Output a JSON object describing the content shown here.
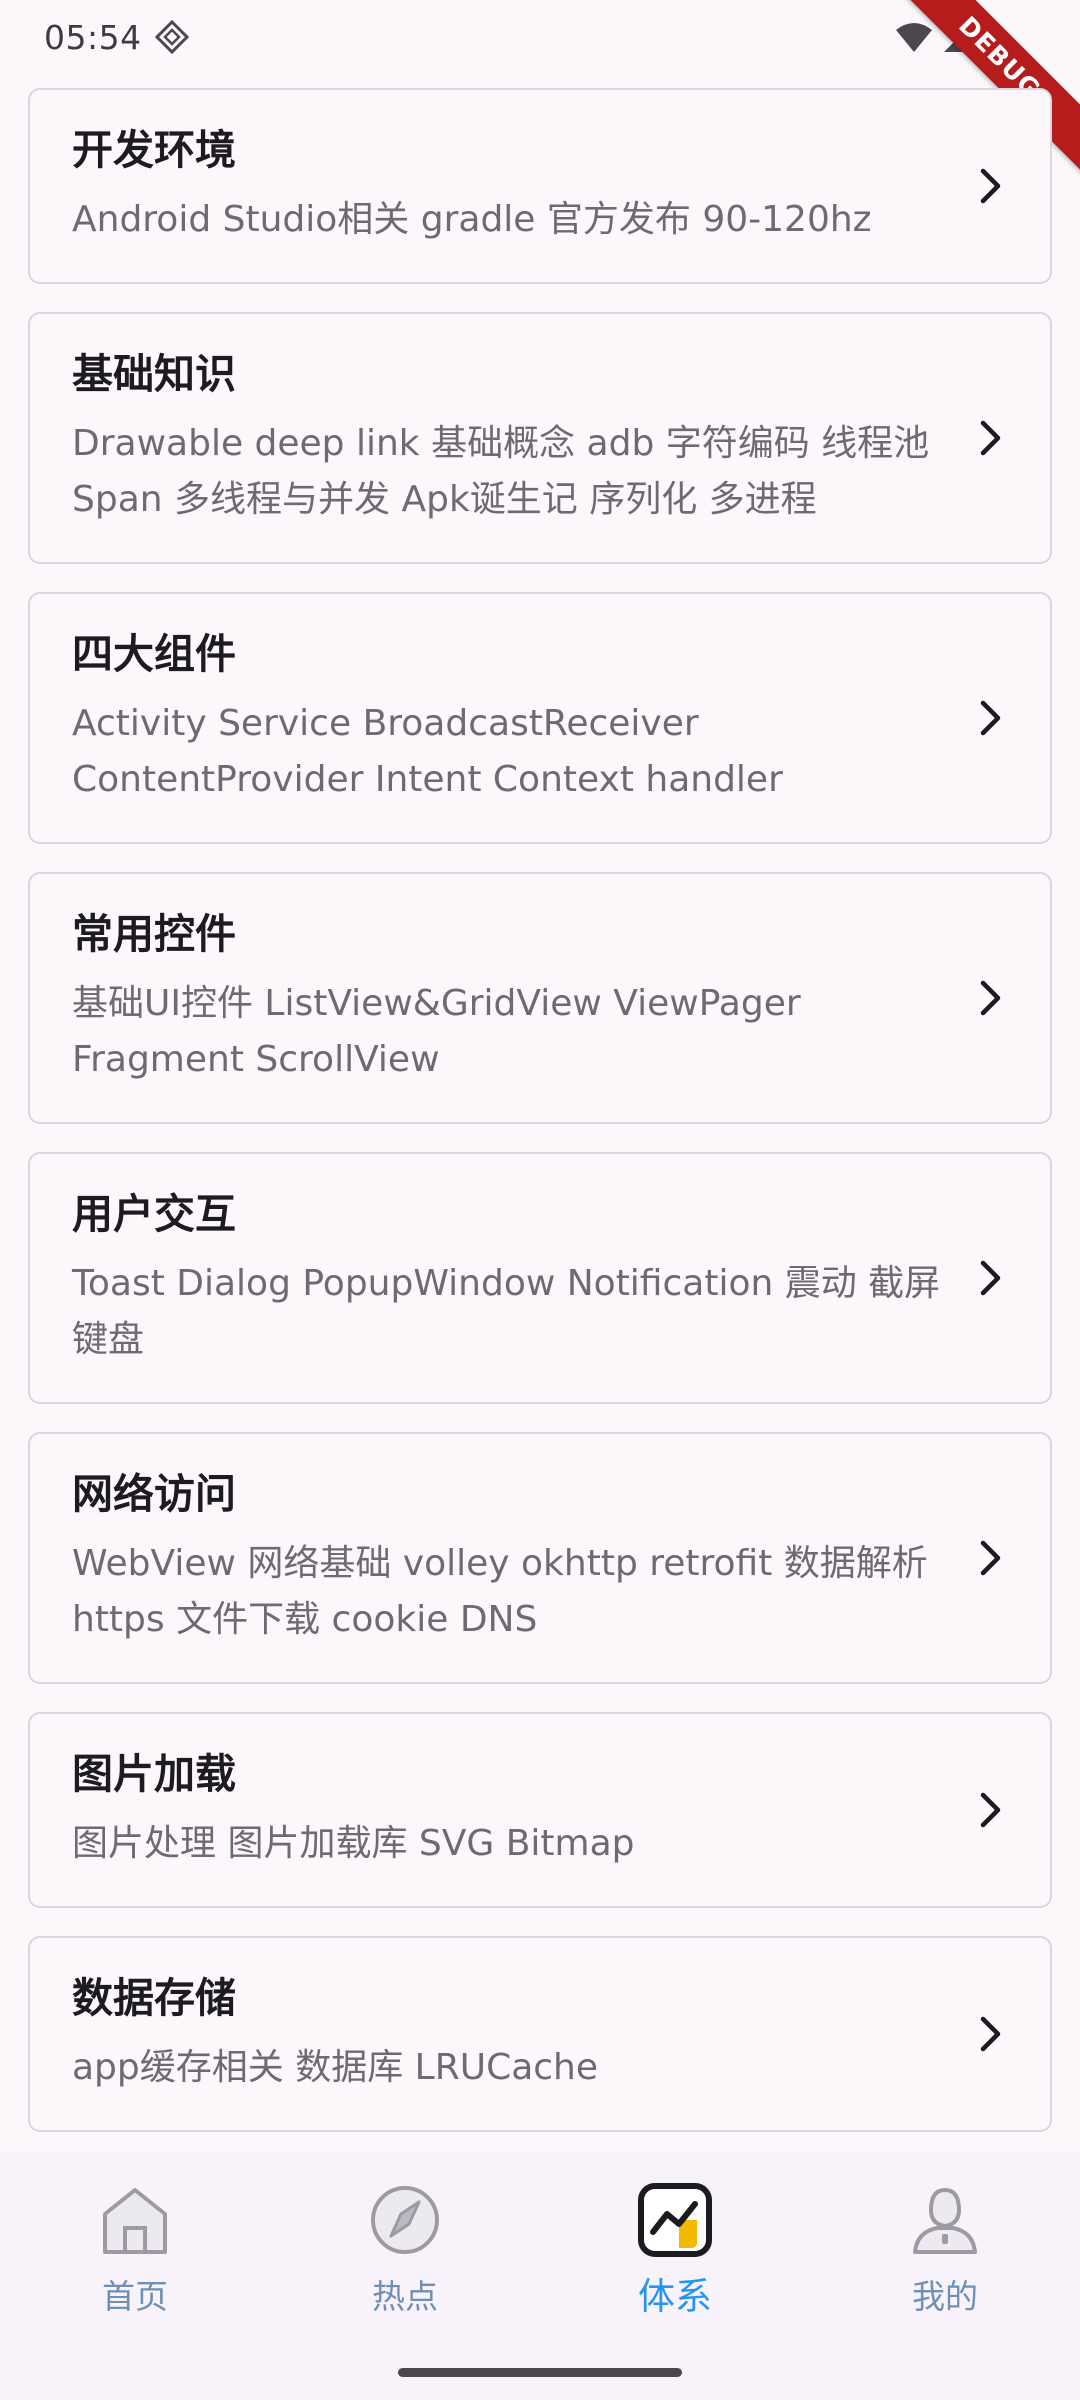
{
  "status_bar": {
    "time": "05:54",
    "debug_label": "DEBUG"
  },
  "categories": [
    {
      "title": "开发环境",
      "subtitle": "Android Studio相关 gradle 官方发布 90-120hz"
    },
    {
      "title": "基础知识",
      "subtitle": "Drawable deep link 基础概念 adb 字符编码 线程池 Span 多线程与并发 Apk诞生记 序列化 多进程"
    },
    {
      "title": "四大组件",
      "subtitle": "Activity Service BroadcastReceiver ContentProvider Intent Context handler"
    },
    {
      "title": "常用控件",
      "subtitle": "基础UI控件 ListView&GridView ViewPager Fragment ScrollView"
    },
    {
      "title": "用户交互",
      "subtitle": "Toast Dialog PopupWindow Notification 震动 截屏 键盘"
    },
    {
      "title": "网络访问",
      "subtitle": "WebView 网络基础 volley okhttp retrofit 数据解析 https 文件下载 cookie DNS"
    },
    {
      "title": "图片加载",
      "subtitle": "图片处理 图片加载库 SVG Bitmap"
    },
    {
      "title": "数据存储",
      "subtitle": "app缓存相关 数据库 LRUCache"
    }
  ],
  "bottom_nav": [
    {
      "label": "首页",
      "icon": "home-icon"
    },
    {
      "label": "热点",
      "icon": "hot-icon"
    },
    {
      "label": "体系",
      "icon": "system-icon",
      "active": true
    },
    {
      "label": "我的",
      "icon": "profile-icon"
    }
  ],
  "colors": {
    "accent": "#2196f3",
    "inactive": "#6f8fb3",
    "active_icon_fill": "#f5b800"
  }
}
